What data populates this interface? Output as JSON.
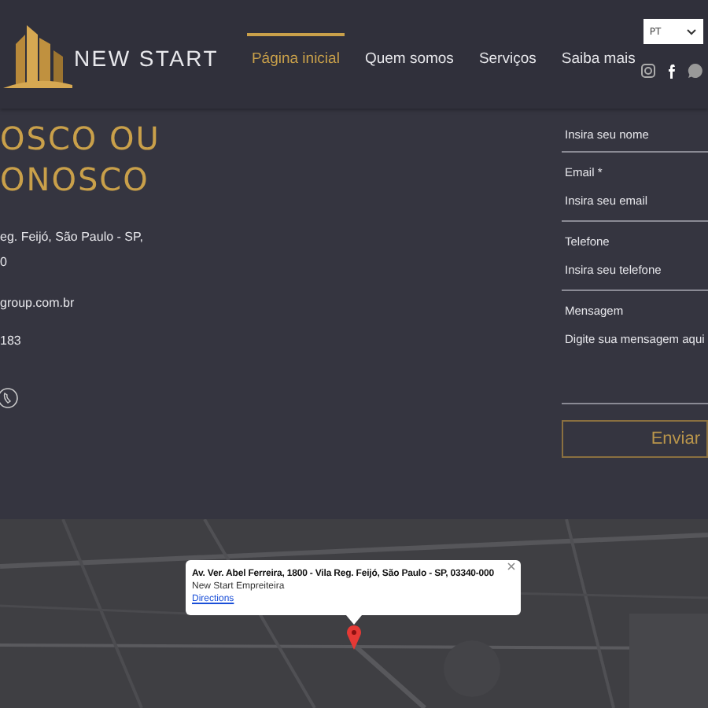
{
  "header": {
    "logo_text": "NEW START",
    "nav": [
      {
        "label": "Página inicial",
        "selected": true
      },
      {
        "label": "Quem somos",
        "selected": false
      },
      {
        "label": "Serviços",
        "selected": false
      },
      {
        "label": "Saiba mais",
        "selected": false
      }
    ],
    "language": {
      "value": "PT"
    }
  },
  "contact": {
    "heading_lines": [
      "OSCO OU",
      "ONOSCO"
    ],
    "address_lines": [
      "eg. Feijó, São Paulo - SP,",
      "0"
    ],
    "email": "group.com.br",
    "phone": "183"
  },
  "form": {
    "fields": [
      {
        "kind": "line",
        "placeholder": "Insira seu nome"
      },
      {
        "kind": "line",
        "label": "Email *",
        "placeholder": "Insira seu email"
      },
      {
        "kind": "line",
        "label": "Telefone",
        "placeholder": "Insira seu telefone"
      },
      {
        "kind": "area",
        "label": "Mensagem",
        "placeholder": "Digite sua mensagem aqui"
      }
    ],
    "submit": "Enviar"
  },
  "map": {
    "info": {
      "address": "Av. Ver. Abel Ferreira, 1800 - Vila Reg. Feijó, São Paulo - SP, 03340-000",
      "name": "New Start Empreiteira",
      "link": "Directions"
    }
  }
}
